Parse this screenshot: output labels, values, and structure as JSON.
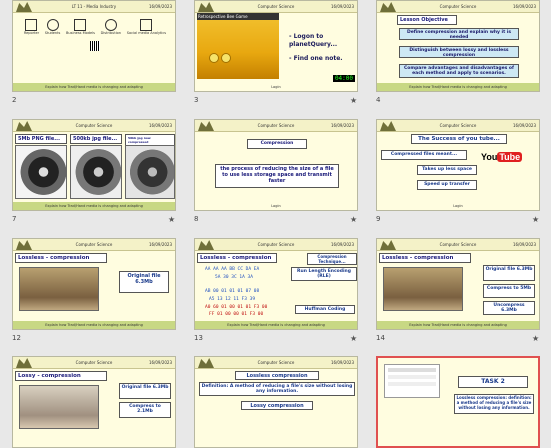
{
  "header_title": "Computer Science",
  "date": "16/09/2023",
  "footer": "Explain how Trad/Hand media is changing and adapting",
  "slides": [
    {
      "num": "2",
      "title": "LT 11 - Media Industry",
      "icons": [
        "Reporter",
        "Students",
        "Business Models",
        "Distribution",
        "Promotion",
        "Social media Analytics"
      ]
    },
    {
      "num": "3",
      "title": "Computer Science",
      "lines": [
        "Retrospective Bee Game",
        "- Logon to planetQuery...",
        "- Find one note."
      ],
      "timer": "04:00",
      "link": "Login"
    },
    {
      "num": "4",
      "title": "Computer Science",
      "heading": "Lesson Objective",
      "lines": [
        "Define compression and explain why it is needed",
        "Distinguish between lossy and lossless compression",
        "Compare advantages and disadvantages of each method and apply to scenarios."
      ]
    },
    {
      "num": "7",
      "title": "Computer Science",
      "cols": [
        "5Mb PNG file...",
        "500kb jpg file...",
        "50kb jpg now compressed"
      ]
    },
    {
      "num": "8",
      "title": "Computer Science",
      "heading": "Compression",
      "lines": [
        "the process of reducing the size of a file to use less storage space and transmit faster"
      ],
      "link": "Login"
    },
    {
      "num": "9",
      "title": "Computer Science",
      "heading": "The Success of you tube...",
      "lines": [
        "Compressed files meant...",
        "Takes up less space",
        "Speed up transfer"
      ],
      "link": "Login",
      "brand": "YouTube"
    },
    {
      "num": "12",
      "title": "Computer Science",
      "heading": "Lossless - compression",
      "boxes": [
        "Original file 6.3Mb"
      ]
    },
    {
      "num": "13",
      "title": "Computer Science",
      "heading": "Lossless - compression",
      "boxes": [
        "Compression Technique...",
        "Run Length Encoding (RLE)",
        "Huffman Coding"
      ],
      "hex": [
        "AA AA AA BB CC DA EA",
        "5A 30 3C 1A 3A",
        "AB 00 01 01 01 07 08",
        "A5 13 12 11 F3 39",
        "A0 60 01 00 01 01 F3 00",
        "FF 01 00 00 01 F3 00"
      ]
    },
    {
      "num": "14",
      "title": "Computer Science",
      "heading": "Lossless - compression",
      "boxes": [
        "Original file 6.3Mb",
        "Compress to 5Mb",
        "Uncompress 6.3Mb"
      ]
    },
    {
      "num": "15",
      "title": "Computer Science",
      "heading": "Lossy - compression",
      "boxes": [
        "Original file 6.3Mb",
        "Compress to 2.1Mb"
      ]
    },
    {
      "num": "16",
      "title": "Computer Science",
      "heading": "Lossless compression",
      "lines": [
        "Definition: A method of reducing a file's size without losing any information.",
        "Lossy compression"
      ]
    },
    {
      "num": "17",
      "title": "Computer Science",
      "heading": "TASK 2",
      "lines": [
        "Lossless compression: definition: a method of reducing a file's size without losing any information."
      ]
    }
  ]
}
